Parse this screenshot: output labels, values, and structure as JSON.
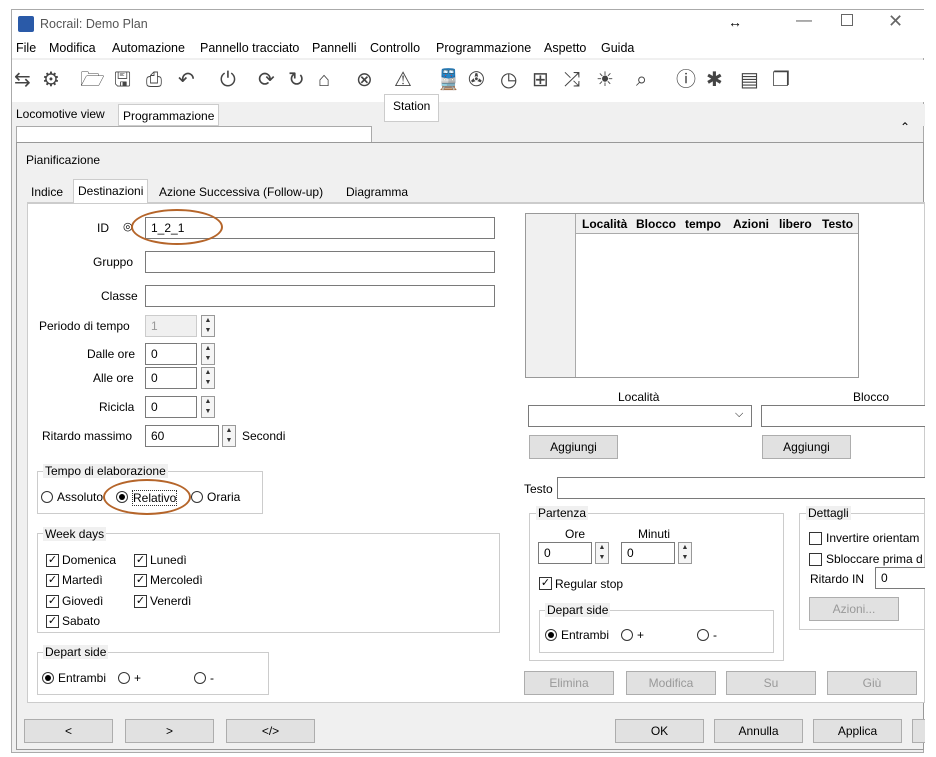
{
  "window": {
    "title": "Rocrail: Demo Plan"
  },
  "menu": [
    "File",
    "Modifica",
    "Automazione",
    "Pannello tracciato",
    "Pannelli",
    "Controllo",
    "Programmazione",
    "Aspetto",
    "Guida"
  ],
  "main_tabs": [
    "Locomotive view",
    "Programmazione"
  ],
  "station_tab": "Station",
  "dialog": {
    "title": "Pianificazione",
    "tabs": [
      "Indice",
      "Destinazioni",
      "Azione Successiva (Follow-up)",
      "Diagramma"
    ],
    "fields": {
      "id_label": "ID",
      "id_value": "1_2_1",
      "gruppo_label": "Gruppo",
      "classe_label": "Classe",
      "periodo_label": "Periodo di tempo",
      "periodo_value": "1",
      "dalle_label": "Dalle ore",
      "dalle_value": "0",
      "alle_label": "Alle ore",
      "alle_value": "0",
      "ricicla_label": "Ricicla",
      "ricicla_value": "0",
      "ritardo_label": "Ritardo massimo",
      "ritardo_value": "60",
      "secondi_label": "Secondi"
    },
    "tempo": {
      "label": "Tempo di elaborazione",
      "options": [
        "Assoluto",
        "Relativo",
        "Oraria"
      ],
      "selected": "Relativo"
    },
    "weekdays": {
      "label": "Week days",
      "days": [
        "Domenica",
        "Lunedì",
        "Martedì",
        "Mercoledì",
        "Giovedì",
        "Venerdì",
        "Sabato"
      ]
    },
    "depart_side": {
      "label": "Depart side",
      "options": [
        "Entrambi",
        "+",
        "-"
      ],
      "selected": "Entrambi"
    },
    "table": {
      "columns": [
        "Località",
        "Blocco",
        "tempo",
        "Azioni",
        "libero",
        "Testo"
      ]
    },
    "localita_label": "Località",
    "blocco_label": "Blocco",
    "aggiungi": "Aggiungi",
    "testo_label": "Testo",
    "partenza": {
      "label": "Partenza",
      "ore_label": "Ore",
      "minuti_label": "Minuti",
      "ore_value": "0",
      "minuti_value": "0",
      "regular_stop": "Regular stop"
    },
    "depart_side2": {
      "label": "Depart side",
      "options": [
        "Entrambi",
        "+",
        "-"
      ]
    },
    "dettagli": {
      "label": "Dettagli",
      "invertire": "Invertire orientam",
      "sbloccare": "Sbloccare prima d",
      "ritardo_in_label": "Ritardo IN",
      "ritardo_in_value": "0",
      "azioni": "Azioni..."
    },
    "row_buttons": [
      "Elimina",
      "Modifica",
      "Su",
      "Giù"
    ],
    "nav_buttons": [
      "<",
      ">",
      "</>"
    ],
    "ok": "OK",
    "annulla": "Annulla",
    "applica": "Applica"
  }
}
